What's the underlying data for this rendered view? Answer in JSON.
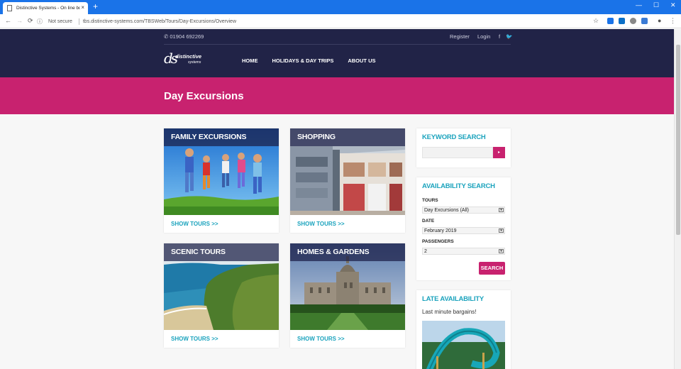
{
  "browser": {
    "tab_title": "Distinctive Systems - On line bo...",
    "tab_close": "×",
    "new_tab": "+",
    "security": "Not secure",
    "url": "tbs.distinctive-systems.com/TBSWeb/Tours/Day-Excursions/Overview",
    "window_controls": [
      "—",
      "☐",
      "✕"
    ]
  },
  "header": {
    "phone_icon": "phone-icon",
    "phone": "01904 692269",
    "register": "Register",
    "login": "Login",
    "facebook": "f",
    "twitter": "t",
    "logo_mark": "ds",
    "logo_text": "distinctive",
    "logo_sub": "systems",
    "nav": [
      "HOME",
      "HOLIDAYS & DAY TRIPS",
      "ABOUT US"
    ]
  },
  "banner": {
    "title": "Day Excursions"
  },
  "cards": [
    {
      "title": "FAMILY EXCURSIONS",
      "link": "SHOW TOURS >>"
    },
    {
      "title": "SHOPPING",
      "link": "SHOW TOURS >>"
    },
    {
      "title": "SCENIC TOURS",
      "link": "SHOW TOURS >>"
    },
    {
      "title": "HOMES & GARDENS",
      "link": "SHOW TOURS >>"
    }
  ],
  "keyword": {
    "title": "KEYWORD SEARCH",
    "button": "▸",
    "value": ""
  },
  "availability": {
    "title": "AVAILABILITY SEARCH",
    "tours_label": "TOURS",
    "tours_value": "Day Excursions (All)",
    "date_label": "DATE",
    "date_value": "February 2019",
    "pax_label": "PASSENGERS",
    "pax_value": "2",
    "button": "SEARCH"
  },
  "late": {
    "title": "LATE AVAILABILITY",
    "text": "Last minute bargains!"
  },
  "colors": {
    "navy": "#212347",
    "magenta": "#c8226f",
    "teal": "#1ba3bd"
  }
}
